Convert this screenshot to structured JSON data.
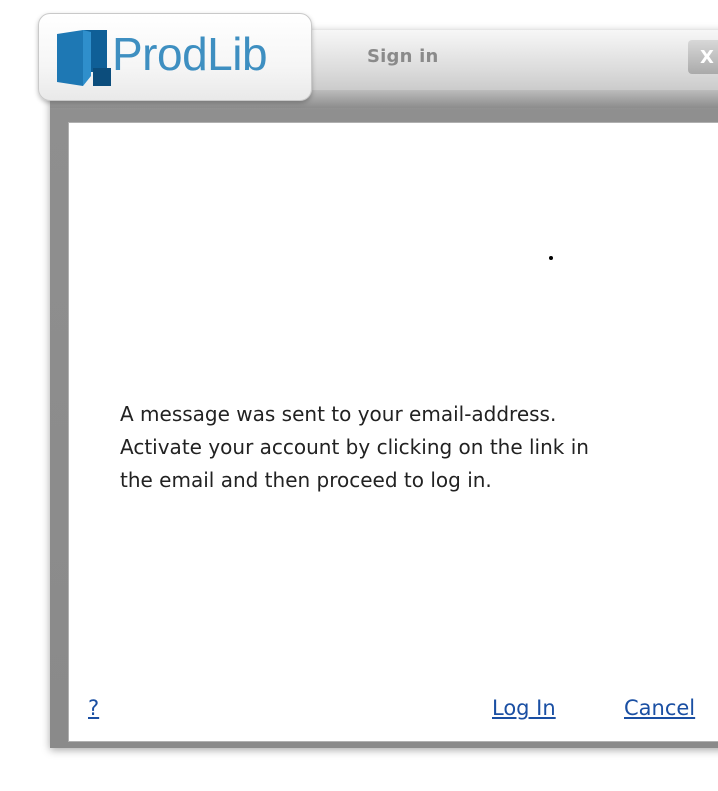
{
  "app": {
    "logo_text": "ProdLib",
    "brand_color": "#3e8fc1",
    "logo_icon": "book-icon"
  },
  "window": {
    "title": "Sign in",
    "close_label": "X"
  },
  "content": {
    "message_lines": [
      "A message was sent to your email-address.",
      "Activate your account by clicking on the link in",
      "the email and then proceed to log in."
    ]
  },
  "footer": {
    "help_label": "?",
    "login_label": "Log In",
    "cancel_label": "Cancel",
    "link_color": "#1a4fa3"
  }
}
